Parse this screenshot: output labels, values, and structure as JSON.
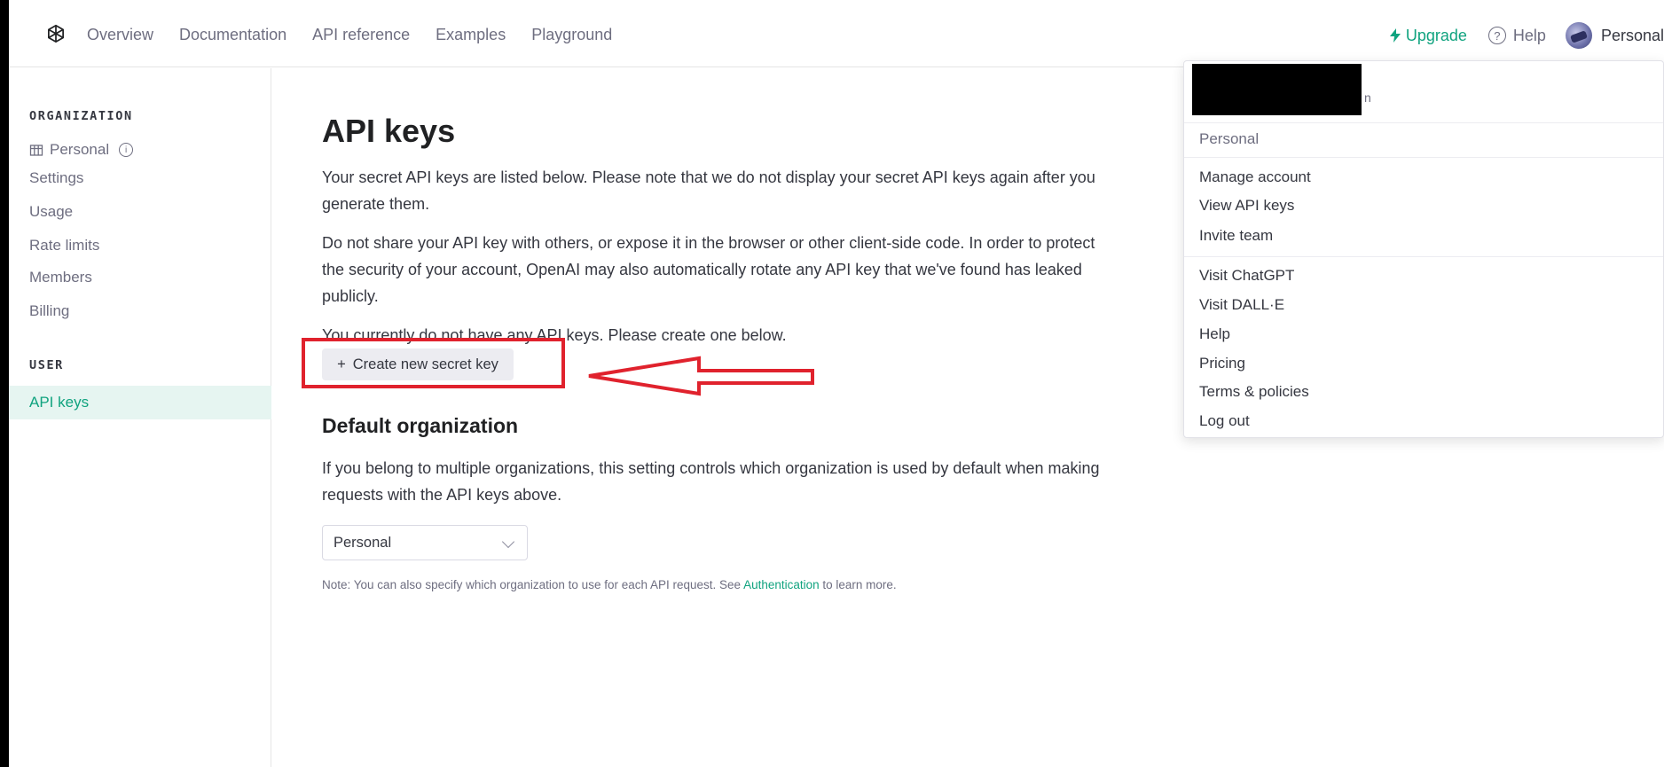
{
  "nav": {
    "links": [
      "Overview",
      "Documentation",
      "API reference",
      "Examples",
      "Playground"
    ],
    "upgrade": "Upgrade",
    "help": "Help",
    "help_glyph": "?",
    "account": "Personal"
  },
  "sidebar": {
    "org_heading": "ORGANIZATION",
    "org_name": "Personal",
    "info_glyph": "i",
    "org_items": [
      "Settings",
      "Usage",
      "Rate limits",
      "Members",
      "Billing"
    ],
    "user_heading": "USER",
    "user_items": [
      "API keys"
    ]
  },
  "main": {
    "title": "API keys",
    "para1": "Your secret API keys are listed below. Please note that we do not display your secret API keys again after you generate them.",
    "para2": "Do not share your API key with others, or expose it in the browser or other client-side code. In order to protect the security of your account, OpenAI may also automatically rotate any API key that we've found has leaked publicly.",
    "para3": "You currently do not have any API keys. Please create one below.",
    "create_button": "Create new secret key",
    "create_glyph": "+",
    "default_org_title": "Default organization",
    "default_org_desc": "If you belong to multiple organizations, this setting controls which organization is used by default when making requests with the API keys above.",
    "org_select_value": "Personal",
    "note_prefix": "Note: You can also specify which organization to use for each API request. See ",
    "note_link": "Authentication",
    "note_suffix": " to learn more."
  },
  "dropdown": {
    "header_tail": "n",
    "org_label": "Personal",
    "account_items": [
      "Manage account",
      "View API keys",
      "Invite team"
    ],
    "link_items": [
      "Visit ChatGPT",
      "Visit DALL·E",
      "Help",
      "Pricing",
      "Terms & policies",
      "Log out"
    ]
  },
  "colors": {
    "accent": "#10a37f",
    "annotation_red": "#e0222d"
  }
}
